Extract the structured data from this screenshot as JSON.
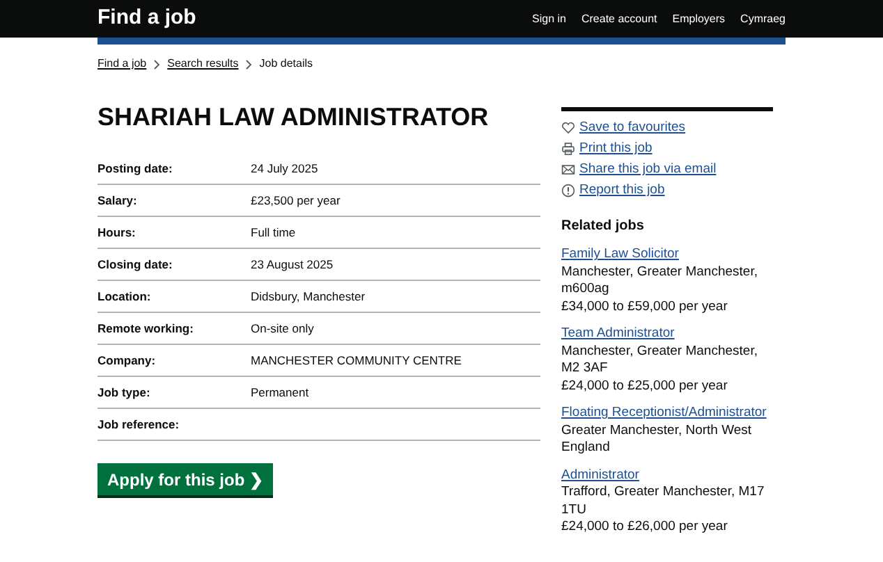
{
  "header": {
    "title": "Find a job",
    "nav": [
      "Sign in",
      "Create account",
      "Employers",
      "Cymraeg"
    ]
  },
  "breadcrumbs": [
    {
      "label": "Find a job",
      "link": true
    },
    {
      "label": "Search results",
      "link": true
    },
    {
      "label": "Job details",
      "link": false
    }
  ],
  "job": {
    "title": "SHARIAH LAW ADMINISTRATOR",
    "details": [
      {
        "label": "Posting date:",
        "value": "24 July 2025"
      },
      {
        "label": "Salary:",
        "value": "£23,500 per year"
      },
      {
        "label": "Hours:",
        "value": "Full time"
      },
      {
        "label": "Closing date:",
        "value": "23 August 2025"
      },
      {
        "label": "Location:",
        "value": "Didsbury, Manchester"
      },
      {
        "label": "Remote working:",
        "value": "On-site only"
      },
      {
        "label": "Company:",
        "value": "MANCHESTER COMMUNITY CENTRE"
      },
      {
        "label": "Job type:",
        "value": "Permanent"
      },
      {
        "label": "Job reference:"
      }
    ],
    "apply_button": "Apply for this job ❯"
  },
  "actions": [
    {
      "kind": "heart",
      "label": "Save to favourites"
    },
    {
      "kind": "print",
      "label": "Print this job"
    },
    {
      "kind": "email",
      "label": "Share this job via email"
    },
    {
      "kind": "report",
      "label": "Report this job"
    }
  ],
  "related": {
    "heading": "Related jobs",
    "jobs": [
      {
        "title": "Family Law Solicitor",
        "location": "Manchester, Greater Manchester, m600ag",
        "salary": "£34,000 to £59,000 per year"
      },
      {
        "title": "Team Administrator",
        "location": "Manchester, Greater Manchester, M2 3AF",
        "salary": "£24,000 to £25,000 per year"
      },
      {
        "title": "Floating Receptionist/Administrator",
        "location": "Greater Manchester, North West England"
      },
      {
        "title": "Administrator",
        "location": "Trafford, Greater Manchester, M17 1TU",
        "salary": "£24,000 to £26,000 per year"
      }
    ]
  }
}
